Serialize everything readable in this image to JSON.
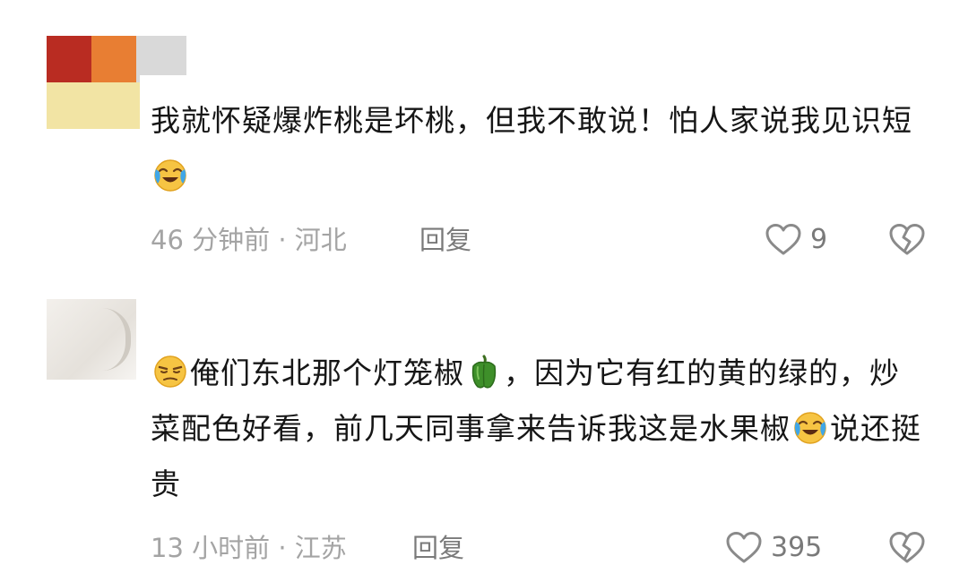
{
  "comments": [
    {
      "avatar": {
        "colors": [
          "#b92c22",
          "#e87e33",
          "#f2e4a4",
          "#d8d8d8"
        ]
      },
      "text_segments": [
        {
          "type": "text",
          "value": "我就怀疑爆炸桃是坏桃，但我不敢说！怕人家说我见识短"
        },
        {
          "type": "emoji",
          "icon": "laugh-cry-emoji"
        }
      ],
      "meta": "46 分钟前 · 河北",
      "reply_label": "回复",
      "like_count": "9"
    },
    {
      "avatar": {
        "colors": [
          "#e8e4de",
          "#f3f0ec"
        ]
      },
      "text_segments": [
        {
          "type": "emoji",
          "icon": "smirk-emoji"
        },
        {
          "type": "text",
          "value": "俺们东北那个灯笼椒"
        },
        {
          "type": "emoji",
          "icon": "green-pepper-emoji"
        },
        {
          "type": "text",
          "value": "，因为它有红的黄的绿的，炒菜配色好看，前几天同事拿来告诉我这是水果椒"
        },
        {
          "type": "emoji",
          "icon": "laugh-cry-emoji"
        },
        {
          "type": "text",
          "value": "说还挺贵"
        }
      ],
      "meta": "13 小时前 · 江苏",
      "reply_label": "回复",
      "like_count": "395"
    }
  ]
}
